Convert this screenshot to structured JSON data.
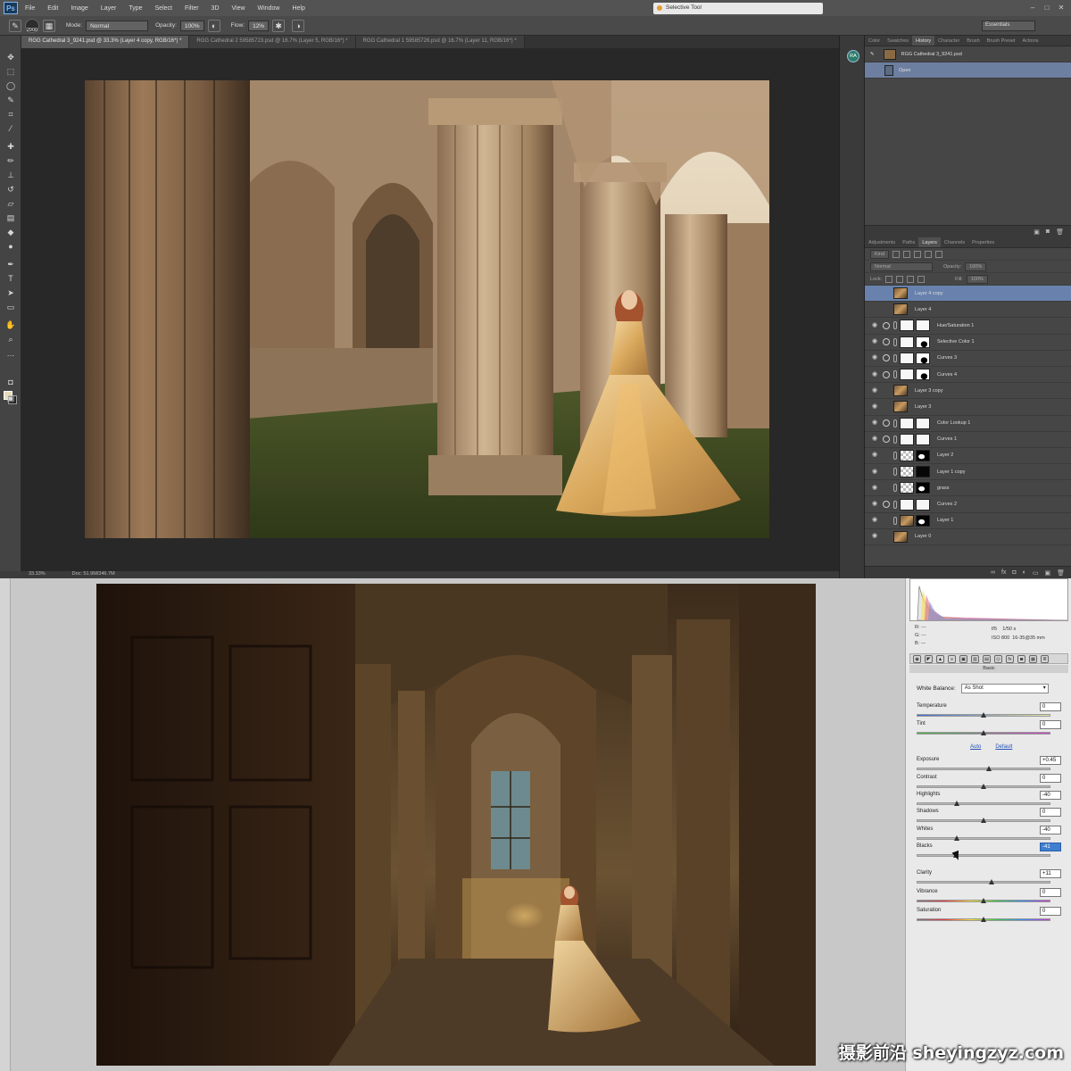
{
  "app": {
    "logo": "Ps"
  },
  "menu": [
    "File",
    "Edit",
    "Image",
    "Layer",
    "Type",
    "Select",
    "Filter",
    "3D",
    "View",
    "Window",
    "Help"
  ],
  "search_box": {
    "text": "Selective Tool"
  },
  "options_bar": {
    "brush_size": "2900",
    "mode_label": "Mode:",
    "mode_value": "Normal",
    "opacity_label": "Opacity:",
    "opacity_value": "100%",
    "flow_label": "Flow:",
    "flow_value": "12%",
    "workspace": "Essentials"
  },
  "doc_tabs": [
    {
      "label": "RGG Cathedral 3_9241.psd @ 33.3% (Layer 4 copy, RGB/16*) *",
      "active": true
    },
    {
      "label": "RGG Cathedral 2 59585723.psd @ 16.7% (Layer 5, RGB/16*) *",
      "active": false
    },
    {
      "label": "RGG Cathedral 1 59585726.psd @ 16.7% (Layer 11, RGB/16*) *",
      "active": false
    }
  ],
  "status": {
    "zoom": "33.33%",
    "doc": "Doc: 51.9M/346.7M"
  },
  "user_badge": "RA",
  "history_panel": {
    "tabs": [
      "Color",
      "Swatches",
      "History",
      "Character",
      "Brush",
      "Brush Preset",
      "Actions"
    ],
    "active_tab": "History",
    "snapshot": "RGG Cathedral 3_9241.psd",
    "steps": [
      "Open"
    ]
  },
  "layers_panel": {
    "tabs": [
      "Adjustments",
      "Paths",
      "Layers",
      "Channels",
      "Properties"
    ],
    "active_tab": "Layers",
    "filter_kind": "Kind",
    "blend_mode": "Normal",
    "opacity_label": "Opacity:",
    "opacity_value": "100%",
    "lock_label": "Lock:",
    "fill_label": "Fill:",
    "fill_value": "100%",
    "layers": [
      {
        "name": "Layer 4 copy",
        "thumb": "photo",
        "mask": null,
        "selected": true,
        "adjustment": false
      },
      {
        "name": "Layer 4",
        "thumb": "photo",
        "mask": null,
        "selected": false,
        "adjustment": false
      },
      {
        "name": "Hue/Saturation 1",
        "thumb": "white",
        "mask": "white",
        "selected": false,
        "adjustment": true
      },
      {
        "name": "Selective Color 1",
        "thumb": "white",
        "mask": "mask-shape",
        "selected": false,
        "adjustment": true
      },
      {
        "name": "Curves 3",
        "thumb": "white",
        "mask": "mask-shape",
        "selected": false,
        "adjustment": true
      },
      {
        "name": "Curves 4",
        "thumb": "white",
        "mask": "mask-shape",
        "selected": false,
        "adjustment": true
      },
      {
        "name": "Layer 3 copy",
        "thumb": "photo",
        "mask": null,
        "selected": false,
        "adjustment": false
      },
      {
        "name": "Layer 3",
        "thumb": "photo",
        "mask": null,
        "selected": false,
        "adjustment": false
      },
      {
        "name": "Color Lookup 1",
        "thumb": "white",
        "mask": "white",
        "selected": false,
        "adjustment": true
      },
      {
        "name": "Curves 1",
        "thumb": "white",
        "mask": "white",
        "selected": false,
        "adjustment": true
      },
      {
        "name": "Layer 2",
        "thumb": "checker",
        "mask": "mask-inv",
        "selected": false,
        "adjustment": false
      },
      {
        "name": "Layer 1 copy",
        "thumb": "checker",
        "mask": "black",
        "selected": false,
        "adjustment": false
      },
      {
        "name": "grass",
        "thumb": "checker",
        "mask": "mask-inv",
        "selected": false,
        "adjustment": false
      },
      {
        "name": "Curves 2",
        "thumb": "white",
        "mask": "white",
        "selected": false,
        "adjustment": true
      },
      {
        "name": "Layer 1",
        "thumb": "photo",
        "mask": "mask-inv",
        "selected": false,
        "adjustment": false
      },
      {
        "name": "Layer 0",
        "thumb": "photo",
        "mask": null,
        "selected": false,
        "adjustment": false
      }
    ]
  },
  "camera_raw": {
    "readout": {
      "r": "R:",
      "g": "G:",
      "b": "B:",
      "r_val": "---",
      "g_val": "---",
      "b_val": "---",
      "aperture": "f/5",
      "shutter": "1/50 s",
      "iso": "ISO 800",
      "lens": "16-35@35 mm"
    },
    "tab_icons": [
      "◉",
      "◤",
      "▲",
      "≡",
      "▣",
      "▥",
      "▤",
      "◎",
      "fx",
      "◙",
      "▦",
      "≣"
    ],
    "section": "Basic",
    "white_balance_label": "White Balance:",
    "white_balance_value": "As Shot",
    "auto_label": "Auto",
    "default_label": "Default",
    "sliders": [
      {
        "key": "temperature",
        "label": "Temperature",
        "value": "0",
        "pos": 0.5,
        "track": "temp"
      },
      {
        "key": "tint",
        "label": "Tint",
        "value": "0",
        "pos": 0.5,
        "track": "tint"
      },
      {
        "key": "exposure",
        "label": "Exposure",
        "value": "+0.45",
        "pos": 0.54,
        "track": "plain"
      },
      {
        "key": "contrast",
        "label": "Contrast",
        "value": "0",
        "pos": 0.5,
        "track": "plain"
      },
      {
        "key": "highlights",
        "label": "Highlights",
        "value": "-40",
        "pos": 0.3,
        "track": "plain"
      },
      {
        "key": "shadows",
        "label": "Shadows",
        "value": "0",
        "pos": 0.5,
        "track": "plain"
      },
      {
        "key": "whites",
        "label": "Whites",
        "value": "-40",
        "pos": 0.3,
        "track": "plain"
      },
      {
        "key": "blacks",
        "label": "Blacks",
        "value": "-41",
        "pos": 0.29,
        "track": "plain",
        "active": true
      },
      {
        "key": "clarity",
        "label": "Clarity",
        "value": "+11",
        "pos": 0.56,
        "track": "plain"
      },
      {
        "key": "vibrance",
        "label": "Vibrance",
        "value": "0",
        "pos": 0.5,
        "track": "sat"
      },
      {
        "key": "saturation",
        "label": "Saturation",
        "value": "0",
        "pos": 0.5,
        "track": "sat"
      }
    ]
  },
  "watermark": "摄影前沿 sheyingzyz.com"
}
